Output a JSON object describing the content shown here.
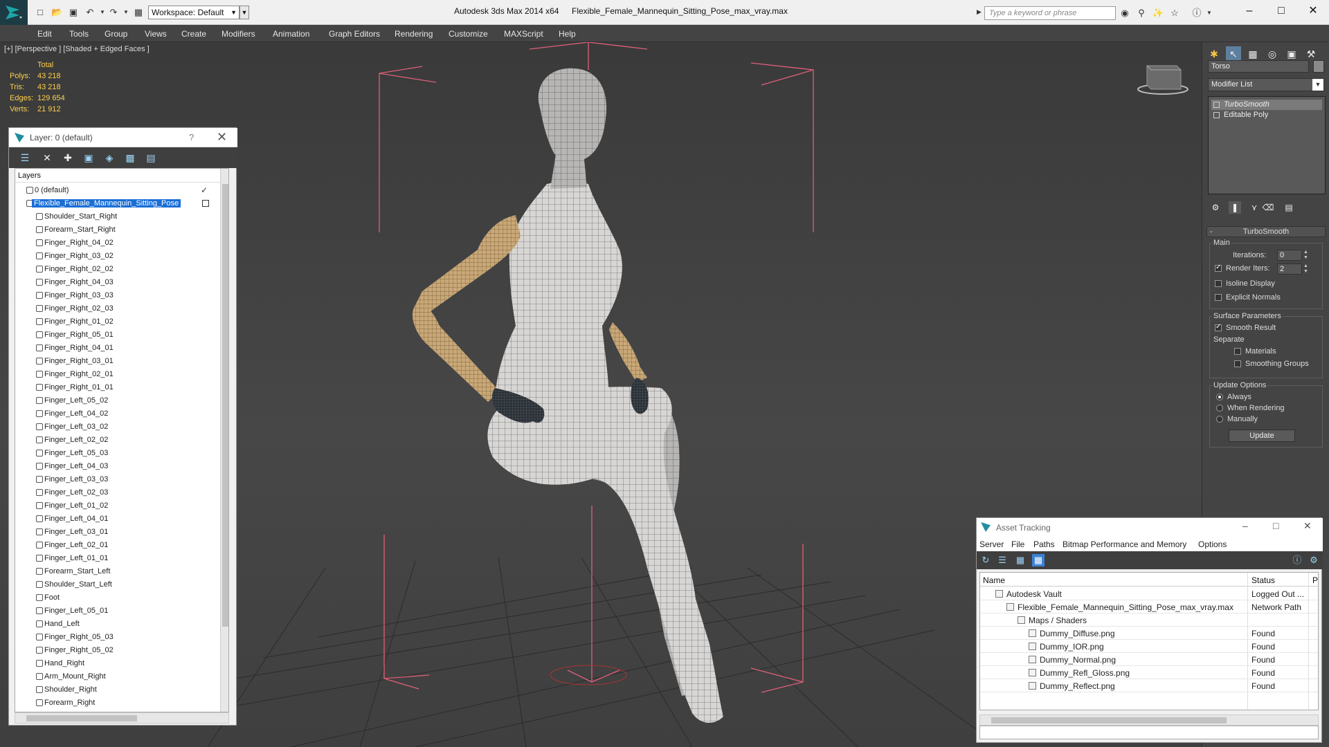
{
  "titlebar": {
    "workspace": "Workspace: Default",
    "app_title": "Autodesk 3ds Max  2014 x64",
    "file_title": "Flexible_Female_Mannequin_Sitting_Pose_max_vray.max",
    "search_placeholder": "Type a keyword or phrase"
  },
  "menu": [
    "Edit",
    "Tools",
    "Group",
    "Views",
    "Create",
    "Modifiers",
    "Animation",
    "Graph Editors",
    "Rendering",
    "Customize",
    "MAXScript",
    "Help"
  ],
  "viewport": {
    "label": "[+] [Perspective ] [Shaded + Edged Faces ]",
    "stats_header": "Total",
    "stats": [
      {
        "key": "Polys:",
        "value": "43 218"
      },
      {
        "key": "Tris:",
        "value": "43 218"
      },
      {
        "key": "Edges:",
        "value": "129 654"
      },
      {
        "key": "Verts:",
        "value": "21 912"
      }
    ]
  },
  "layers": {
    "title": "Layer: 0 (default)",
    "help": "?",
    "header": "Layers",
    "root": "0 (default)",
    "selected": "Flexible_Female_Mannequin_Sitting_Pose",
    "items": [
      "Shoulder_Start_Right",
      "Forearm_Start_Right",
      "Finger_Right_04_02",
      "Finger_Right_03_02",
      "Finger_Right_02_02",
      "Finger_Right_04_03",
      "Finger_Right_03_03",
      "Finger_Right_02_03",
      "Finger_Right_01_02",
      "Finger_Right_05_01",
      "Finger_Right_04_01",
      "Finger_Right_03_01",
      "Finger_Right_02_01",
      "Finger_Right_01_01",
      "Finger_Left_05_02",
      "Finger_Left_04_02",
      "Finger_Left_03_02",
      "Finger_Left_02_02",
      "Finger_Left_05_03",
      "Finger_Left_04_03",
      "Finger_Left_03_03",
      "Finger_Left_02_03",
      "Finger_Left_01_02",
      "Finger_Left_04_01",
      "Finger_Left_03_01",
      "Finger_Left_02_01",
      "Finger_Left_01_01",
      "Forearm_Start_Left",
      "Shoulder_Start_Left",
      "Foot",
      "Finger_Left_05_01",
      "Hand_Left",
      "Finger_Right_05_03",
      "Finger_Right_05_02",
      "Hand_Right",
      "Arm_Mount_Right",
      "Shoulder_Right",
      "Forearm_Right"
    ]
  },
  "command_panel": {
    "object_name": "Torso",
    "modifier_list": "Modifier List",
    "stack": [
      "TurboSmooth",
      "Editable Poly"
    ],
    "rollout_title": "TurboSmooth",
    "main_label": "Main",
    "iterations_label": "Iterations:",
    "iterations": "0",
    "render_iters_label": "Render Iters:",
    "render_iters": "2",
    "render_iters_checked": true,
    "isoline": "Isoline Display",
    "explicit_normals": "Explicit Normals",
    "surface_params": "Surface Parameters",
    "smooth_result": "Smooth Result",
    "smooth_result_checked": true,
    "separate": "Separate",
    "materials": "Materials",
    "smoothing_groups": "Smoothing Groups",
    "update_options": "Update Options",
    "always": "Always",
    "when_rendering": "When Rendering",
    "manually": "Manually",
    "update_button": "Update"
  },
  "asset_tracking": {
    "title": "Asset Tracking",
    "menu": [
      "Server",
      "File",
      "Paths",
      "Bitmap Performance and Memory",
      "Options"
    ],
    "col_name": "Name",
    "col_status": "Status",
    "col_extra": "Pr",
    "rows": [
      {
        "name": "Autodesk Vault",
        "status": "Logged Out ...",
        "indent": 1
      },
      {
        "name": "Flexible_Female_Mannequin_Sitting_Pose_max_vray.max",
        "status": "Network Path",
        "indent": 2
      },
      {
        "name": "Maps / Shaders",
        "status": "",
        "indent": 3
      },
      {
        "name": "Dummy_Diffuse.png",
        "status": "Found",
        "indent": 4
      },
      {
        "name": "Dummy_IOR.png",
        "status": "Found",
        "indent": 4
      },
      {
        "name": "Dummy_Normal.png",
        "status": "Found",
        "indent": 4
      },
      {
        "name": "Dummy_Refl_Gloss.png",
        "status": "Found",
        "indent": 4
      },
      {
        "name": "Dummy_Reflect.png",
        "status": "Found",
        "indent": 4
      }
    ]
  },
  "colors": {
    "stats": "#ffd04b",
    "selection": "#1a6fd6",
    "bbox": "#e0607a",
    "viewport_bg": "#444444"
  }
}
